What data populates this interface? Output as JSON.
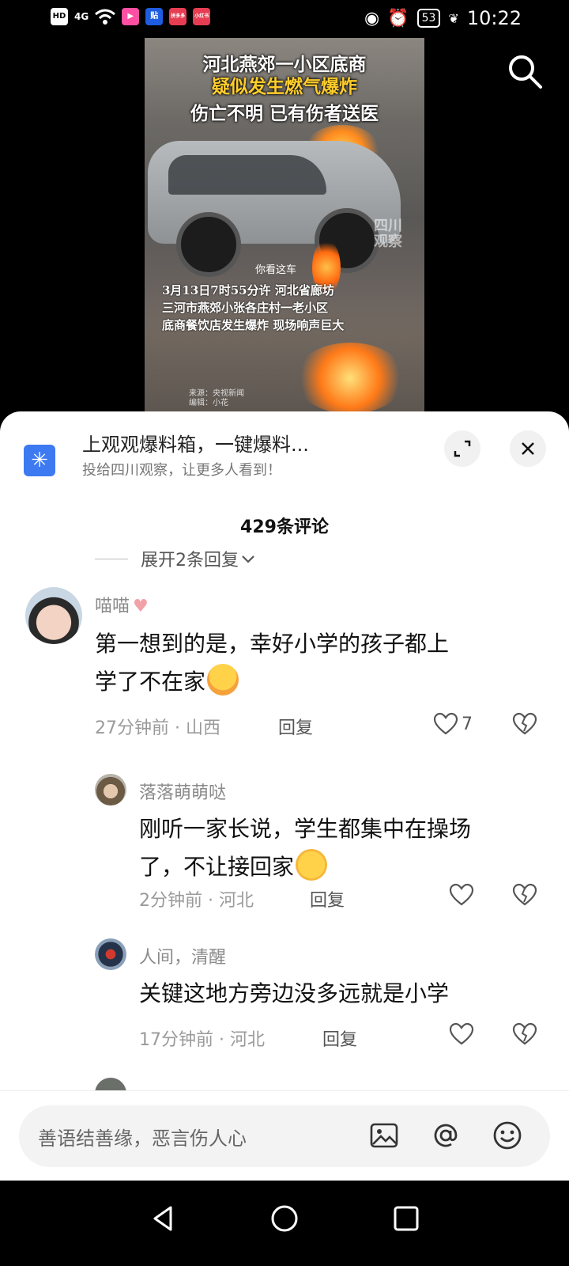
{
  "status_bar": {
    "hd": "HD",
    "signal": "4G",
    "app_icon_tieba": "贴",
    "app_icon_pdd": "拼多多",
    "app_icon_xhs": "小红书",
    "battery": "53",
    "time": "10:22"
  },
  "video": {
    "title_line1": "河北燕郊一小区底商",
    "title_line2": "疑似发生燃气爆炸",
    "title_line3": "伤亡不明 已有伤者送医",
    "overlay_small": "你看这车",
    "caption_line1": "3月13日7时55分许 河北省廊坊",
    "caption_line2": "三河市燕郊小张各庄村一老小区",
    "caption_line3": "底商餐饮店发生爆炸 现场响声巨大",
    "source_line1": "来源：央视新闻",
    "source_line2": "编辑：小花",
    "watermark": "四川观察"
  },
  "ad": {
    "title": "上观观爆料箱，一键爆料...",
    "subtitle": "投给四川观察，让更多人看到！"
  },
  "comments_header": "429条评论",
  "expand_replies": "展开2条回复",
  "comments": [
    {
      "user": "喵喵",
      "text_line1": "第一想到的是，幸好小学的孩子都上",
      "text_line2": "学了不在家",
      "meta": "27分钟前 · 山西",
      "reply": "回复",
      "likes": "7"
    },
    {
      "user": "落落萌萌哒",
      "text_line1": "刚听一家长说，学生都集中在操场",
      "text_line2": "了，不让接回家",
      "meta": "2分钟前 · 河北",
      "reply": "回复"
    },
    {
      "user": "人间，清醒",
      "text_line1": "关键这地方旁边没多远就是小学",
      "meta": "17分钟前 · 河北",
      "reply": "回复"
    }
  ],
  "input": {
    "placeholder": "善语结善缘，恶言伤人心"
  },
  "colors": {
    "accent_blue": "#3d7af2",
    "heart_pink": "#f2a1a8",
    "title_yellow": "#ffcd2b"
  }
}
